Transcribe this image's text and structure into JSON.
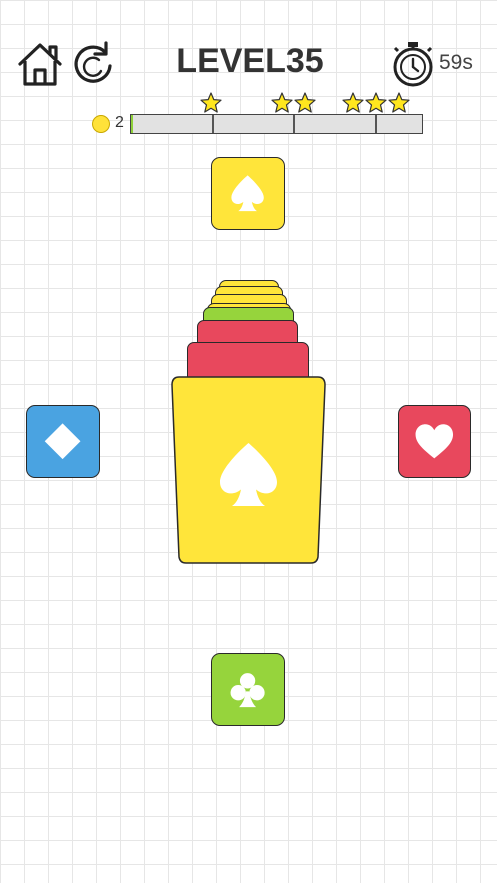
{
  "header": {
    "level_text": "LEVEL35",
    "timer_text": "59s",
    "home_icon": "home-icon",
    "restart_icon": "restart-icon",
    "timer_icon": "stopwatch-icon"
  },
  "progress": {
    "coins": "2",
    "fill_fraction": 0.005,
    "star_milestones": [
      {
        "stars": 1
      },
      {
        "stars": 2
      },
      {
        "stars": 3
      }
    ]
  },
  "targets": {
    "top": {
      "suit": "spade",
      "color": "#ffe53a"
    },
    "left": {
      "suit": "diamond",
      "color": "#4aa3e1"
    },
    "right": {
      "suit": "heart",
      "color": "#e8485d"
    },
    "bottom": {
      "suit": "club",
      "color": "#96d43c"
    }
  },
  "stack": {
    "top_card": {
      "suit": "spade",
      "color": "#ffe53a"
    },
    "layers_below": [
      {
        "color": "#ffe53a"
      },
      {
        "color": "#ffe53a"
      },
      {
        "color": "#ffe53a"
      },
      {
        "color": "#ffe53a"
      },
      {
        "color": "#96d43c"
      },
      {
        "color": "#e8485d"
      },
      {
        "color": "#e8485d"
      }
    ]
  },
  "colors": {
    "yellow": "#ffe53a",
    "blue": "#4aa3e1",
    "red": "#e8485d",
    "green": "#96d43c",
    "progress_fill": "#8fd13a",
    "star": "#ffe61e"
  }
}
